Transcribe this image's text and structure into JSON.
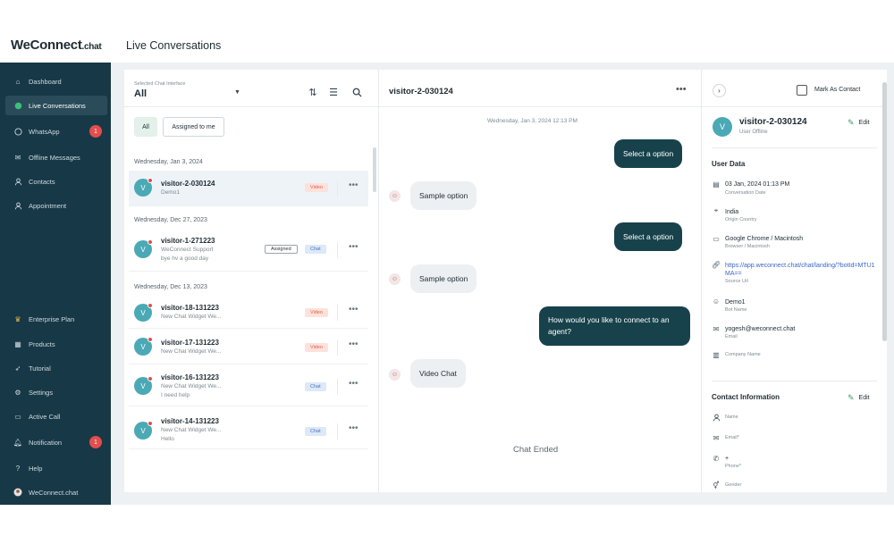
{
  "brand": {
    "prefix": "WeConnect",
    "suffix": ".chat"
  },
  "page_title": "Live Conversations",
  "sidebar": {
    "items": [
      {
        "label": "Dashboard",
        "icon": "home-icon"
      },
      {
        "label": "Live Conversations",
        "icon": "chat-bubble-icon",
        "active": true
      },
      {
        "label": "WhatsApp",
        "icon": "whatsapp-icon",
        "badge": "1"
      },
      {
        "label": "Offline Messages",
        "icon": "mail-icon"
      },
      {
        "label": "Contacts",
        "icon": "user-icon"
      },
      {
        "label": "Appointment",
        "icon": "user-plus-icon"
      }
    ],
    "bottom_items": [
      {
        "label": "Enterprise Plan",
        "icon": "crown-icon"
      },
      {
        "label": "Products",
        "icon": "grid-icon"
      },
      {
        "label": "Tutorial",
        "icon": "rocket-icon"
      },
      {
        "label": "Settings",
        "icon": "gear-icon"
      },
      {
        "label": "Active Call",
        "icon": "video-icon"
      },
      {
        "label": "Notification",
        "icon": "bell-icon",
        "badge": "1"
      },
      {
        "label": "Help",
        "icon": "help-icon"
      },
      {
        "label": "WeConnect.chat",
        "icon": "account-avatar-icon"
      }
    ]
  },
  "list": {
    "select_label": "Selected Chat Interface",
    "select_value": "All",
    "filters": [
      "All",
      "Assigned to me"
    ],
    "groups": [
      {
        "date": "Wednesday, Jan 3, 2024",
        "items": [
          {
            "name": "visitor-2-030124",
            "sub1": "Demo1",
            "sub2": "",
            "tag": "Video",
            "avatar": "V"
          }
        ]
      },
      {
        "date": "Wednesday, Dec 27, 2023",
        "items": [
          {
            "name": "visitor-1-271223",
            "sub1": "WeConnect Support",
            "sub2": "bye hv a good day",
            "tag": "Chat",
            "assigned": "Assigned",
            "avatar": "V"
          }
        ]
      },
      {
        "date": "Wednesday, Dec 13, 2023",
        "items": [
          {
            "name": "visitor-18-131223",
            "sub1": "New Chat Widget We...",
            "sub2": "",
            "tag": "Video",
            "avatar": "V"
          },
          {
            "name": "visitor-17-131223",
            "sub1": "New Chat Widget We...",
            "sub2": "",
            "tag": "Video",
            "avatar": "V"
          },
          {
            "name": "visitor-16-131223",
            "sub1": "New Chat Widget We...",
            "sub2": "I need help",
            "tag": "Chat",
            "avatar": "V"
          },
          {
            "name": "visitor-14-131223",
            "sub1": "New Chat Widget We...",
            "sub2": "Hello",
            "tag": "Chat",
            "avatar": "V"
          }
        ]
      }
    ]
  },
  "chat": {
    "title": "visitor-2-030124",
    "date": "Wednesday, Jan 3, 2024 12:13 PM",
    "messages": [
      {
        "dir": "out",
        "text": "Select a option"
      },
      {
        "dir": "in",
        "text": "Sample option"
      },
      {
        "dir": "out",
        "text": "Select a option"
      },
      {
        "dir": "in",
        "text": "Sample option"
      },
      {
        "dir": "out",
        "text": "How would you like to connect to an agent?"
      },
      {
        "dir": "in",
        "text": "Video Chat"
      }
    ],
    "ended": "Chat Ended"
  },
  "info": {
    "mark_label": "Mark As Contact",
    "name": "visitor-2-030124",
    "status": "User Offline",
    "avatar": "V",
    "edit_label": "Edit",
    "user_data_title": "User Data",
    "user_data": [
      {
        "icon": "calendar-icon",
        "value": "03 Jan, 2024 01:13 PM",
        "label": "Conversation Date"
      },
      {
        "icon": "location-pin-icon",
        "value": "India",
        "label": "Origin Country"
      },
      {
        "icon": "monitor-icon",
        "value": "Google Chrome / Macintosh",
        "label": "Browser / Macintosh"
      },
      {
        "icon": "link-icon",
        "value": "https://app.weconnect.chat/chat/landing/?botId=MTU1MA==",
        "label": "Source Url",
        "link": true
      },
      {
        "icon": "bot-icon",
        "value": "Demo1",
        "label": "Bot Name"
      },
      {
        "icon": "mail-icon",
        "value": "yogesh@weconnect.chat",
        "label": "Email"
      },
      {
        "icon": "building-icon",
        "value": "",
        "label": "Company Name"
      }
    ],
    "contact_title": "Contact Information",
    "contact_edit": "Edit",
    "contact": [
      {
        "icon": "user-icon",
        "value": "",
        "label": "Name"
      },
      {
        "icon": "mail-icon",
        "value": "",
        "label": "Email*"
      },
      {
        "icon": "phone-icon",
        "value": "+",
        "label": "Phone*"
      },
      {
        "icon": "gender-icon",
        "value": "",
        "label": "Gender"
      }
    ]
  },
  "colors": {
    "sidebar": "#173847",
    "accent": "#17424b",
    "badge": "#e34d4d",
    "avatar": "#4aa9b4"
  }
}
